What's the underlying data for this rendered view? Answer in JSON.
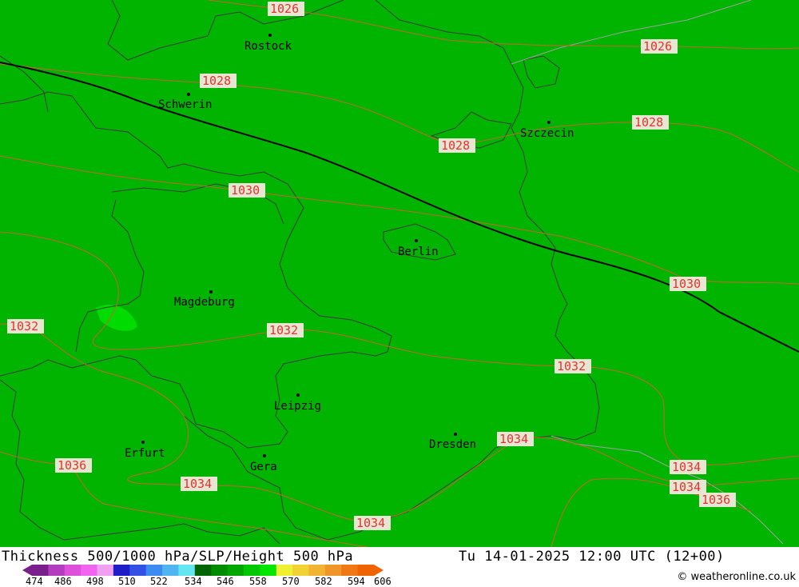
{
  "map": {
    "cities": [
      {
        "name": "Rostock"
      },
      {
        "name": "Schwerin"
      },
      {
        "name": "Szczecin"
      },
      {
        "name": "Berlin"
      },
      {
        "name": "Magdeburg"
      },
      {
        "name": "Leipzig"
      },
      {
        "name": "Dresden"
      },
      {
        "name": "Erfurt"
      },
      {
        "name": "Gera"
      }
    ],
    "isobar_labels": [
      "1026",
      "1026",
      "1028",
      "1028",
      "1028",
      "1030",
      "1030",
      "1032",
      "1032",
      "1032",
      "1034",
      "1034",
      "1034",
      "1034",
      "1036",
      "1036",
      "1034"
    ],
    "background_color": "#00b400",
    "isobar_color": "#c86432",
    "label_text_color": "#e63232",
    "label_box_color": "#e6e6d2",
    "thickness_line_color": "#000000"
  },
  "footer": {
    "title": "Thickness 500/1000 hPa/SLP/Height 500 hPa",
    "datetime": "Tu 14-01-2025 12:00 UTC (12+00)",
    "credit": "© weatheronline.co.uk",
    "legend_values": [
      "474",
      "486",
      "498",
      "510",
      "522",
      "534",
      "546",
      "558",
      "570",
      "582",
      "594",
      "606"
    ],
    "legend_colors": [
      "#7a1e8c",
      "#b43cbe",
      "#dc50dc",
      "#f064f0",
      "#f0a0f0",
      "#1e1ec8",
      "#3250e6",
      "#3c8cf0",
      "#50b4f0",
      "#64e6f0",
      "#006400",
      "#008c00",
      "#00a500",
      "#00c800",
      "#00e600",
      "#f0f032",
      "#f0d232",
      "#f0b432",
      "#f09628",
      "#f07814",
      "#f06400"
    ]
  }
}
